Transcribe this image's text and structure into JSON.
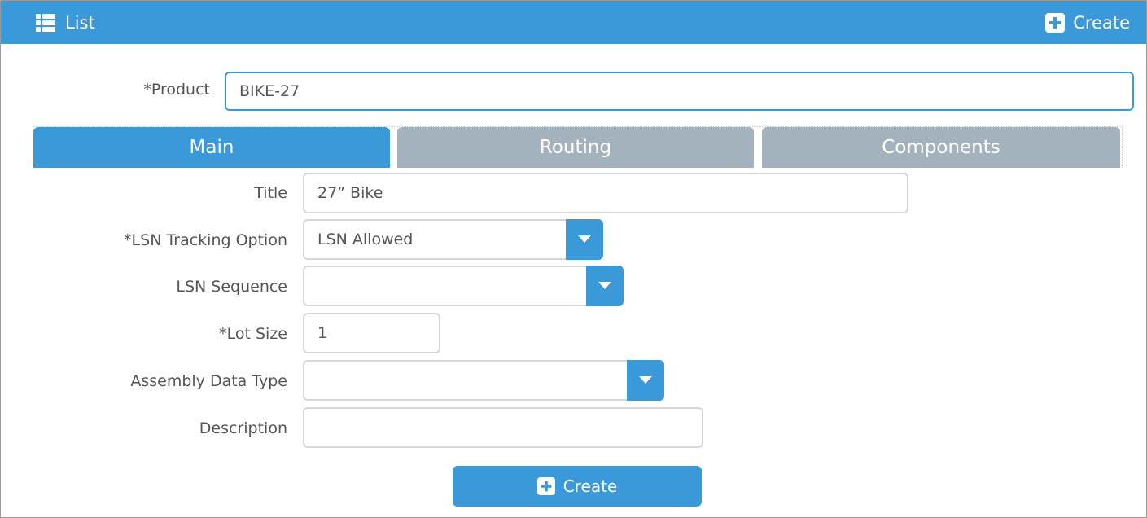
{
  "header": {
    "list_label": "List",
    "list_icon": "list-icon",
    "create_label": "Create",
    "create_icon": "plus-square-icon"
  },
  "product": {
    "label": "*Product",
    "value": "BIKE-27"
  },
  "tabs": [
    {
      "label": "Main",
      "active": true
    },
    {
      "label": "Routing",
      "active": false
    },
    {
      "label": "Components",
      "active": false
    }
  ],
  "form": {
    "title": {
      "label": "Title",
      "value": "27” Bike"
    },
    "lsn_tracking": {
      "label": "*LSN Tracking Option",
      "value": "LSN Allowed"
    },
    "lsn_sequence": {
      "label": "LSN Sequence",
      "value": ""
    },
    "lot_size": {
      "label": "*Lot Size",
      "value": "1"
    },
    "assembly_data_type": {
      "label": "Assembly Data Type",
      "value": ""
    },
    "description": {
      "label": "Description",
      "value": ""
    }
  },
  "submit": {
    "label": "Create",
    "icon": "plus-square-icon"
  },
  "colors": {
    "accent": "#3a99d9",
    "tab_inactive": "#a3b2bd",
    "text": "#555555",
    "border": "#d6d6d6"
  }
}
